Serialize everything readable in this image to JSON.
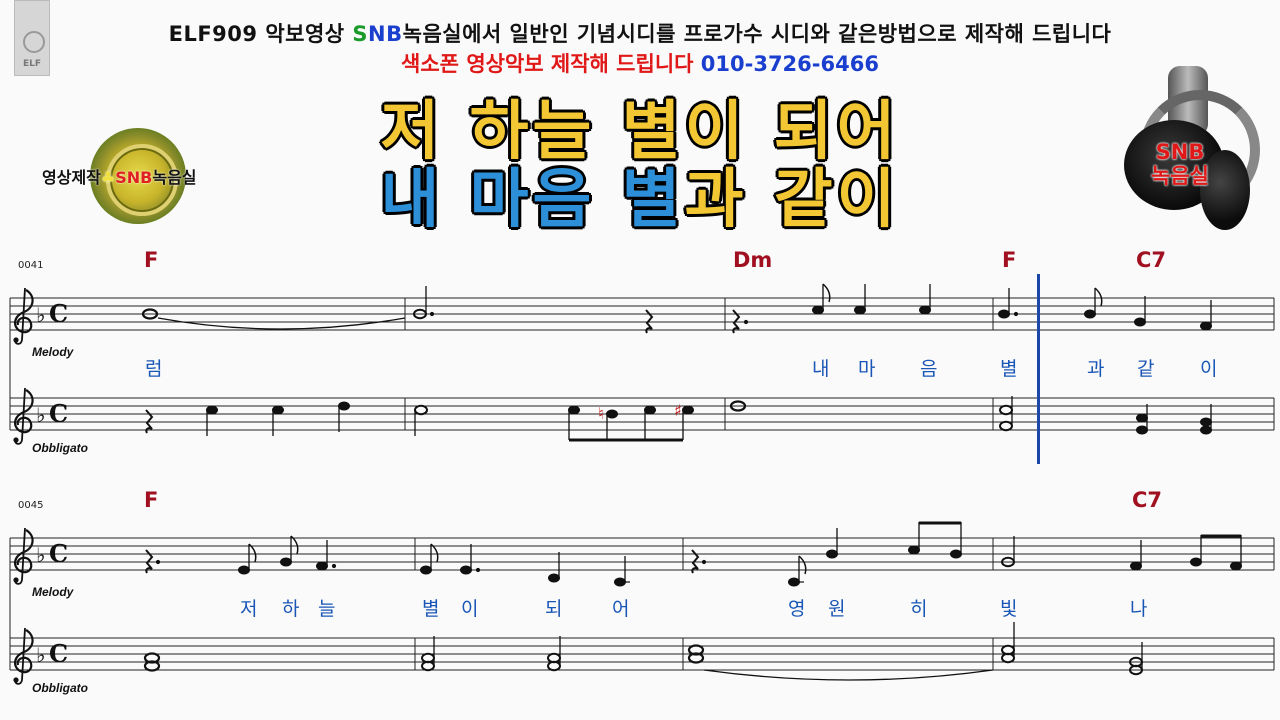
{
  "header": {
    "line1_a": "ELF909 악보영상  ",
    "line1_s": "S",
    "line1_n": "N",
    "line1_b": "B",
    "line1_rest": "녹음실에서 일반인 기념시디를 프로가수 시디와 같은방법으로 제작해 드립니다",
    "line2_text": "색소폰 영상악보 제작해 드립니다 ",
    "line2_phone": "010-3726-6466",
    "colors": {
      "green": "#1a9a2a",
      "blue": "#1a3fcf",
      "red": "#e01818"
    }
  },
  "titles": {
    "line1": "저 하늘 별이 되어",
    "line2_blue": "내 마음 별",
    "line2_gold": "과 같이",
    "colors": {
      "gold": "#f2c733",
      "blue": "#2c8fd8"
    }
  },
  "logos": {
    "left_prefix": "영상제작",
    "left_club": "♣",
    "left_snb": "SNB",
    "left_suffix": "녹음실",
    "right_line1": "SNB",
    "right_line2": "녹음실",
    "corner": "ELF"
  },
  "score": {
    "time_signature": "C",
    "key": "F major",
    "parts": [
      "Melody",
      "Obbligato"
    ],
    "systems": [
      {
        "measure_number": "0041",
        "chords": [
          "F",
          "Dm",
          "F",
          "C7"
        ],
        "lyrics": [
          "럼",
          "내",
          "마",
          "음",
          "별",
          "과",
          "같",
          "이"
        ],
        "melody": [
          "C5 whole (tied)",
          "C5 dotted-half",
          "quarter rest",
          "dotted-quarter rest",
          "D5 eighth",
          "D5 quarter",
          "D5 quarter",
          "C5 dotted-quarter",
          "C5 eighth",
          "A4 quarter",
          "G4 quarter"
        ],
        "obbligato": [
          "quarter rest",
          "C5 quarter",
          "C5 quarter",
          "D5 quarter",
          "C5 half",
          "C5 eighth",
          "B♮4 eighth",
          "C5 eighth",
          "C♯5 eighth",
          "D5 whole",
          "C5/F4 half",
          "A4/E4 quarter",
          "G4/E4 quarter"
        ]
      },
      {
        "measure_number": "0045",
        "chords": [
          "F",
          "C7"
        ],
        "lyrics": [
          "저",
          "하",
          "늘",
          "별",
          "이",
          "되",
          "어",
          "영",
          "원",
          "히",
          "빛",
          "나"
        ],
        "melody": [
          "dotted-quarter rest",
          "F4 eighth",
          "A4 eighth",
          "G4 dotted-quarter",
          "F4 eighth",
          "F4 dotted-quarter",
          "D4 quarter",
          "C4 quarter",
          "dotted-quarter rest",
          "C4 eighth",
          "C5 quarter",
          "D5 eighth",
          "C5 eighth",
          "A4 half",
          "G4 quarter",
          "A4 eighth",
          "G4 eighth"
        ],
        "obbligato": [
          "A4/F4 whole",
          "A4/F4 half",
          "A4/F4 half",
          "C5/A4 whole (tied)",
          "C5/A4 half",
          "G4/E4 half"
        ]
      }
    ]
  }
}
